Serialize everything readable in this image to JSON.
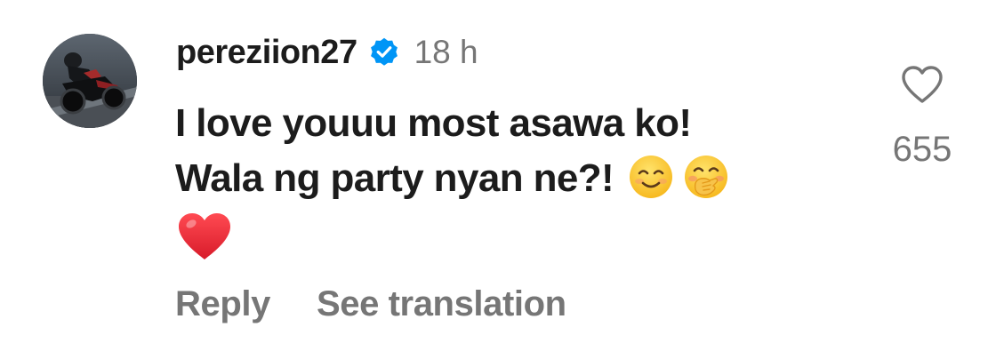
{
  "comment": {
    "username": "pereziion27",
    "timestamp": "18 h",
    "text_line1": "I love youuu most asawa ko!",
    "text_line2": "Wala ng party nyan ne?!",
    "emojis": [
      "smiling-face-emoji",
      "face-with-hand-over-mouth-emoji",
      "red-heart-emoji"
    ],
    "like_count": "655",
    "actions": {
      "reply_label": "Reply",
      "translate_label": "See translation"
    }
  },
  "colors": {
    "text_primary": "#1c1c1c",
    "text_secondary": "#767676",
    "verified_blue": "#0095f6",
    "heart_red": "#e0202e",
    "emoji_yellow": "#fcc21b"
  }
}
